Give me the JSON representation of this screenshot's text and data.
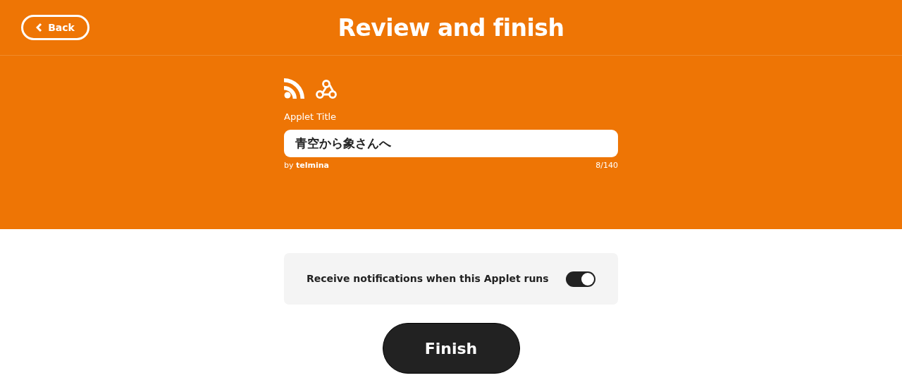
{
  "header": {
    "back_button": "Back",
    "title": "Review and finish"
  },
  "form": {
    "label": "Applet Title",
    "value": "青空から象さんへ",
    "byline": "by **telmina**",
    "counter": "8/140"
  },
  "notification": {
    "label": "Receive notifications when this Applet runs",
    "on": true
  },
  "finish_button": "Finish"
}
